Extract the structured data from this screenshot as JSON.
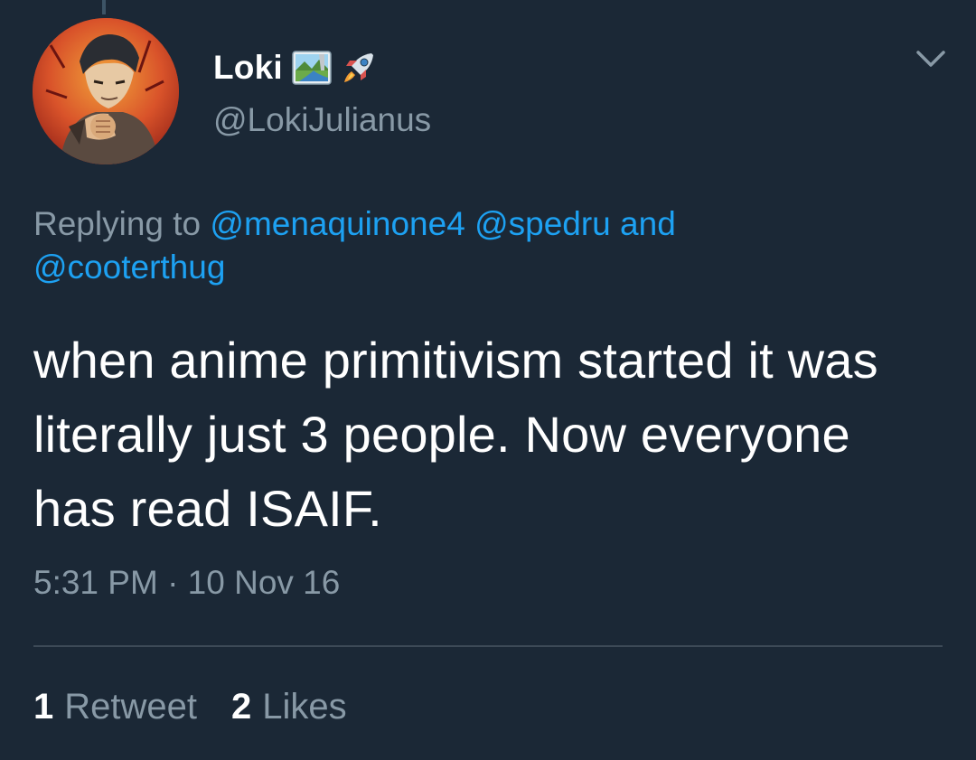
{
  "tweet": {
    "author": {
      "display_name": "Loki",
      "handle": "@LokiJulianus",
      "name_emojis": [
        "national-park-emoji",
        "rocket-emoji"
      ]
    },
    "reply": {
      "prefix": "Replying to",
      "mention_1": "@menaquinone4",
      "mention_2": "@spedru",
      "conjunction": "and",
      "mention_3": "@cooterthug"
    },
    "text": "when anime primitivism started it was literally just 3 people. Now everyone has read ISAIF.",
    "timestamp": "5:31 PM · 10 Nov 16",
    "stats": {
      "retweets_count": "1",
      "retweets_label": "Retweet",
      "likes_count": "2",
      "likes_label": "Likes"
    }
  },
  "colors": {
    "background": "#1b2836",
    "secondary_text": "#8899a6",
    "link": "#1da1f2",
    "primary_text": "#ffffff"
  }
}
